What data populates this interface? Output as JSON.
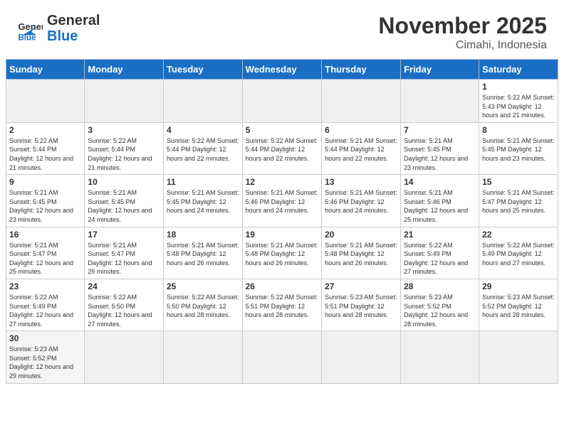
{
  "header": {
    "logo_general": "General",
    "logo_blue": "Blue",
    "month_title": "November 2025",
    "location": "Cimahi, Indonesia"
  },
  "days_of_week": [
    "Sunday",
    "Monday",
    "Tuesday",
    "Wednesday",
    "Thursday",
    "Friday",
    "Saturday"
  ],
  "weeks": [
    [
      {
        "day": "",
        "info": ""
      },
      {
        "day": "",
        "info": ""
      },
      {
        "day": "",
        "info": ""
      },
      {
        "day": "",
        "info": ""
      },
      {
        "day": "",
        "info": ""
      },
      {
        "day": "",
        "info": ""
      },
      {
        "day": "1",
        "info": "Sunrise: 5:22 AM\nSunset: 5:43 PM\nDaylight: 12 hours\nand 21 minutes."
      }
    ],
    [
      {
        "day": "2",
        "info": "Sunrise: 5:22 AM\nSunset: 5:44 PM\nDaylight: 12 hours\nand 21 minutes."
      },
      {
        "day": "3",
        "info": "Sunrise: 5:22 AM\nSunset: 5:44 PM\nDaylight: 12 hours\nand 21 minutes."
      },
      {
        "day": "4",
        "info": "Sunrise: 5:22 AM\nSunset: 5:44 PM\nDaylight: 12 hours\nand 22 minutes."
      },
      {
        "day": "5",
        "info": "Sunrise: 5:22 AM\nSunset: 5:44 PM\nDaylight: 12 hours\nand 22 minutes."
      },
      {
        "day": "6",
        "info": "Sunrise: 5:21 AM\nSunset: 5:44 PM\nDaylight: 12 hours\nand 22 minutes."
      },
      {
        "day": "7",
        "info": "Sunrise: 5:21 AM\nSunset: 5:45 PM\nDaylight: 12 hours\nand 23 minutes."
      },
      {
        "day": "8",
        "info": "Sunrise: 5:21 AM\nSunset: 5:45 PM\nDaylight: 12 hours\nand 23 minutes."
      }
    ],
    [
      {
        "day": "9",
        "info": "Sunrise: 5:21 AM\nSunset: 5:45 PM\nDaylight: 12 hours\nand 23 minutes."
      },
      {
        "day": "10",
        "info": "Sunrise: 5:21 AM\nSunset: 5:45 PM\nDaylight: 12 hours\nand 24 minutes."
      },
      {
        "day": "11",
        "info": "Sunrise: 5:21 AM\nSunset: 5:45 PM\nDaylight: 12 hours\nand 24 minutes."
      },
      {
        "day": "12",
        "info": "Sunrise: 5:21 AM\nSunset: 5:46 PM\nDaylight: 12 hours\nand 24 minutes."
      },
      {
        "day": "13",
        "info": "Sunrise: 5:21 AM\nSunset: 5:46 PM\nDaylight: 12 hours\nand 24 minutes."
      },
      {
        "day": "14",
        "info": "Sunrise: 5:21 AM\nSunset: 5:46 PM\nDaylight: 12 hours\nand 25 minutes."
      },
      {
        "day": "15",
        "info": "Sunrise: 5:21 AM\nSunset: 5:47 PM\nDaylight: 12 hours\nand 25 minutes."
      }
    ],
    [
      {
        "day": "16",
        "info": "Sunrise: 5:21 AM\nSunset: 5:47 PM\nDaylight: 12 hours\nand 25 minutes."
      },
      {
        "day": "17",
        "info": "Sunrise: 5:21 AM\nSunset: 5:47 PM\nDaylight: 12 hours\nand 26 minutes."
      },
      {
        "day": "18",
        "info": "Sunrise: 5:21 AM\nSunset: 5:48 PM\nDaylight: 12 hours\nand 26 minutes."
      },
      {
        "day": "19",
        "info": "Sunrise: 5:21 AM\nSunset: 5:48 PM\nDaylight: 12 hours\nand 26 minutes."
      },
      {
        "day": "20",
        "info": "Sunrise: 5:21 AM\nSunset: 5:48 PM\nDaylight: 12 hours\nand 26 minutes."
      },
      {
        "day": "21",
        "info": "Sunrise: 5:22 AM\nSunset: 5:49 PM\nDaylight: 12 hours\nand 27 minutes."
      },
      {
        "day": "22",
        "info": "Sunrise: 5:22 AM\nSunset: 5:49 PM\nDaylight: 12 hours\nand 27 minutes."
      }
    ],
    [
      {
        "day": "23",
        "info": "Sunrise: 5:22 AM\nSunset: 5:49 PM\nDaylight: 12 hours\nand 27 minutes."
      },
      {
        "day": "24",
        "info": "Sunrise: 5:22 AM\nSunset: 5:50 PM\nDaylight: 12 hours\nand 27 minutes."
      },
      {
        "day": "25",
        "info": "Sunrise: 5:22 AM\nSunset: 5:50 PM\nDaylight: 12 hours\nand 28 minutes."
      },
      {
        "day": "26",
        "info": "Sunrise: 5:22 AM\nSunset: 5:51 PM\nDaylight: 12 hours\nand 28 minutes."
      },
      {
        "day": "27",
        "info": "Sunrise: 5:23 AM\nSunset: 5:51 PM\nDaylight: 12 hours\nand 28 minutes."
      },
      {
        "day": "28",
        "info": "Sunrise: 5:23 AM\nSunset: 5:52 PM\nDaylight: 12 hours\nand 28 minutes."
      },
      {
        "day": "29",
        "info": "Sunrise: 5:23 AM\nSunset: 5:52 PM\nDaylight: 12 hours\nand 28 minutes."
      }
    ],
    [
      {
        "day": "30",
        "info": "Sunrise: 5:23 AM\nSunset: 5:52 PM\nDaylight: 12 hours\nand 29 minutes."
      },
      {
        "day": "",
        "info": ""
      },
      {
        "day": "",
        "info": ""
      },
      {
        "day": "",
        "info": ""
      },
      {
        "day": "",
        "info": ""
      },
      {
        "day": "",
        "info": ""
      },
      {
        "day": "",
        "info": ""
      }
    ]
  ]
}
